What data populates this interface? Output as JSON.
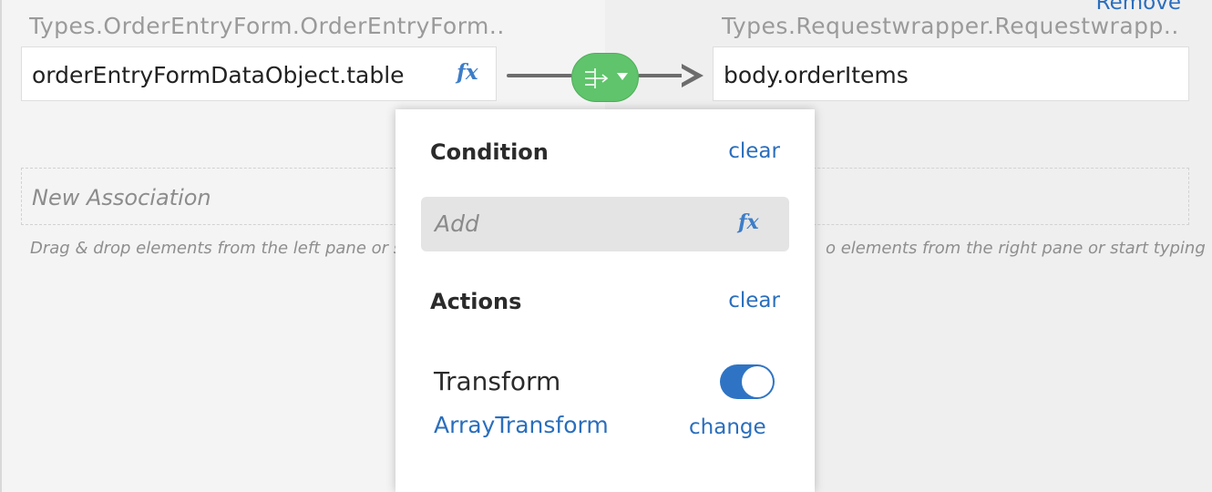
{
  "header": {
    "remove_label": "Remove"
  },
  "source": {
    "type_label": "Types.OrderEntryForm.OrderEntryForm...",
    "value": "orderEntryFormDataObject.table",
    "fx_label": "fx"
  },
  "target": {
    "type_label": "Types.Requestwrapper.Requestwrapp...",
    "value": "body.orderItems"
  },
  "new_association": {
    "placeholder": "New Association",
    "left_hint": "Drag & drop elements from the left pane or st",
    "right_hint": "o elements from the right pane or start typing"
  },
  "popover": {
    "condition_title": "Condition",
    "condition_clear": "clear",
    "condition_placeholder": "Add",
    "condition_fx": "fx",
    "actions_title": "Actions",
    "actions_clear": "clear",
    "transform_label": "Transform",
    "transform_enabled": true,
    "transform_value": "ArrayTransform",
    "change_label": "change"
  },
  "colors": {
    "accent": "#2a6ebd",
    "pill_green": "#5fc46b",
    "toggle_on": "#2f74c4"
  }
}
